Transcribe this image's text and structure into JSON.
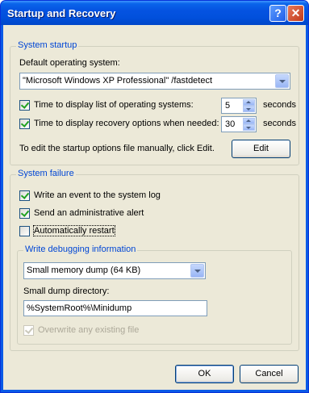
{
  "window": {
    "title": "Startup and Recovery"
  },
  "titlebar": {
    "help_glyph": "?",
    "close_glyph": "✕"
  },
  "system_startup": {
    "group_label": "System startup",
    "default_os_label": "Default operating system:",
    "default_os_value": "\"Microsoft Windows XP Professional\" /fastdetect",
    "display_list": {
      "label": "Time to display list of operating systems:",
      "checked": true,
      "value": "5",
      "unit": "seconds"
    },
    "display_recovery": {
      "label": "Time to display recovery options when needed:",
      "checked": true,
      "value": "30",
      "unit": "seconds"
    },
    "edit_hint": "To edit the startup options file manually, click Edit.",
    "edit_button": "Edit"
  },
  "system_failure": {
    "group_label": "System failure",
    "write_event": {
      "label": "Write an event to the system log",
      "checked": true
    },
    "send_alert": {
      "label": "Send an administrative alert",
      "checked": true
    },
    "auto_restart": {
      "label": "Automatically restart",
      "checked": false
    },
    "debug": {
      "group_label": "Write debugging information",
      "dump_type": "Small memory dump (64 KB)",
      "dir_label": "Small dump directory:",
      "dir_value": "%SystemRoot%\\Minidump",
      "overwrite": {
        "label": "Overwrite any existing file",
        "checked": true,
        "enabled": false
      }
    }
  },
  "buttons": {
    "ok": "OK",
    "cancel": "Cancel"
  }
}
